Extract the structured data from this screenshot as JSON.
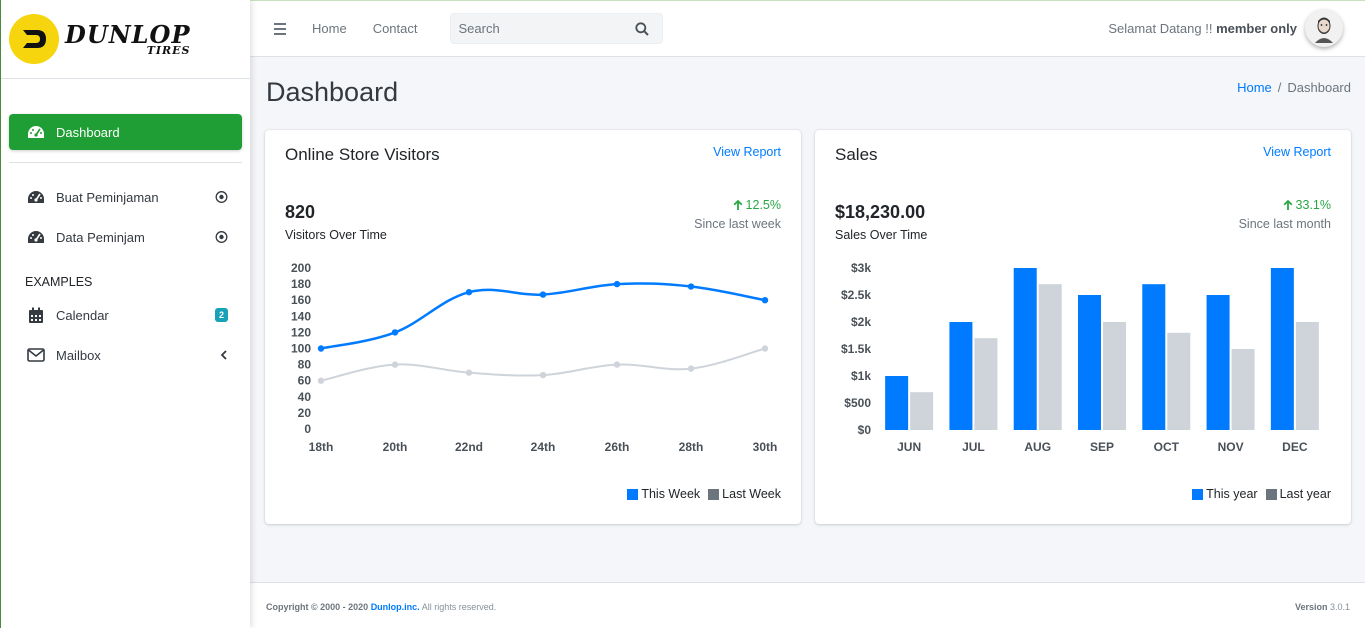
{
  "brand": {
    "name": "DUNLOP",
    "sub": "TIRES"
  },
  "sidebar": {
    "items": [
      {
        "label": "Dashboard",
        "icon": "tachometer-icon",
        "active": true
      },
      {
        "label": "Buat Peminjaman",
        "icon": "tachometer-icon"
      },
      {
        "label": "Data Peminjam",
        "icon": "tachometer-icon"
      }
    ],
    "section_header": "EXAMPLES",
    "examples": [
      {
        "label": "Calendar",
        "icon": "calendar-icon",
        "badge": "2"
      },
      {
        "label": "Mailbox",
        "icon": "envelope-icon"
      }
    ]
  },
  "topbar": {
    "links": [
      "Home",
      "Contact"
    ],
    "search_placeholder": "Search",
    "welcome_prefix": "Selamat Datang !!",
    "welcome_user": "member only"
  },
  "header": {
    "title": "Dashboard",
    "breadcrumb": [
      "Home",
      "Dashboard"
    ]
  },
  "cards": {
    "visitors": {
      "title": "Online Store Visitors",
      "link": "View Report",
      "value": "820",
      "value_label": "Visitors Over Time",
      "delta": "12.5%",
      "since": "Since last week"
    },
    "sales": {
      "title": "Sales",
      "link": "View Report",
      "value": "$18,230.00",
      "value_label": "Sales Over Time",
      "delta": "33.1%",
      "since": "Since last month"
    }
  },
  "colors": {
    "primary": "#007bff",
    "secondary": "#ced4da",
    "legend_secondary": "#6c757d",
    "success": "#28a745",
    "active_nav": "#1e9e34"
  },
  "chart_data": [
    {
      "type": "line",
      "x": [
        "18th",
        "20th",
        "22nd",
        "24th",
        "26th",
        "28th",
        "30th"
      ],
      "series": [
        {
          "name": "This Week",
          "values": [
            100,
            120,
            170,
            167,
            180,
            177,
            160
          ]
        },
        {
          "name": "Last Week",
          "values": [
            60,
            80,
            70,
            67,
            80,
            75,
            100
          ]
        }
      ],
      "ylim": [
        0,
        200
      ],
      "yticks": [
        "200",
        "180",
        "160",
        "140",
        "120",
        "100",
        "80",
        "60",
        "40",
        "20",
        "0"
      ]
    },
    {
      "type": "bar",
      "categories": [
        "JUN",
        "JUL",
        "AUG",
        "SEP",
        "OCT",
        "NOV",
        "DEC"
      ],
      "series": [
        {
          "name": "This year",
          "values": [
            1000,
            2000,
            3000,
            2500,
            2700,
            2500,
            3000
          ]
        },
        {
          "name": "Last year",
          "values": [
            700,
            1700,
            2700,
            2000,
            1800,
            1500,
            2000
          ]
        }
      ],
      "ylim": [
        0,
        3000
      ],
      "yticks": [
        "$3k",
        "$2.5k",
        "$2k",
        "$1.5k",
        "$1k",
        "$500",
        "$0"
      ]
    }
  ],
  "footer": {
    "copyright_prefix": "Copyright © 2000 - 2020",
    "company": "Dunlop.inc.",
    "rights": "All rights reserved.",
    "version_label": "Version",
    "version": "3.0.1"
  }
}
